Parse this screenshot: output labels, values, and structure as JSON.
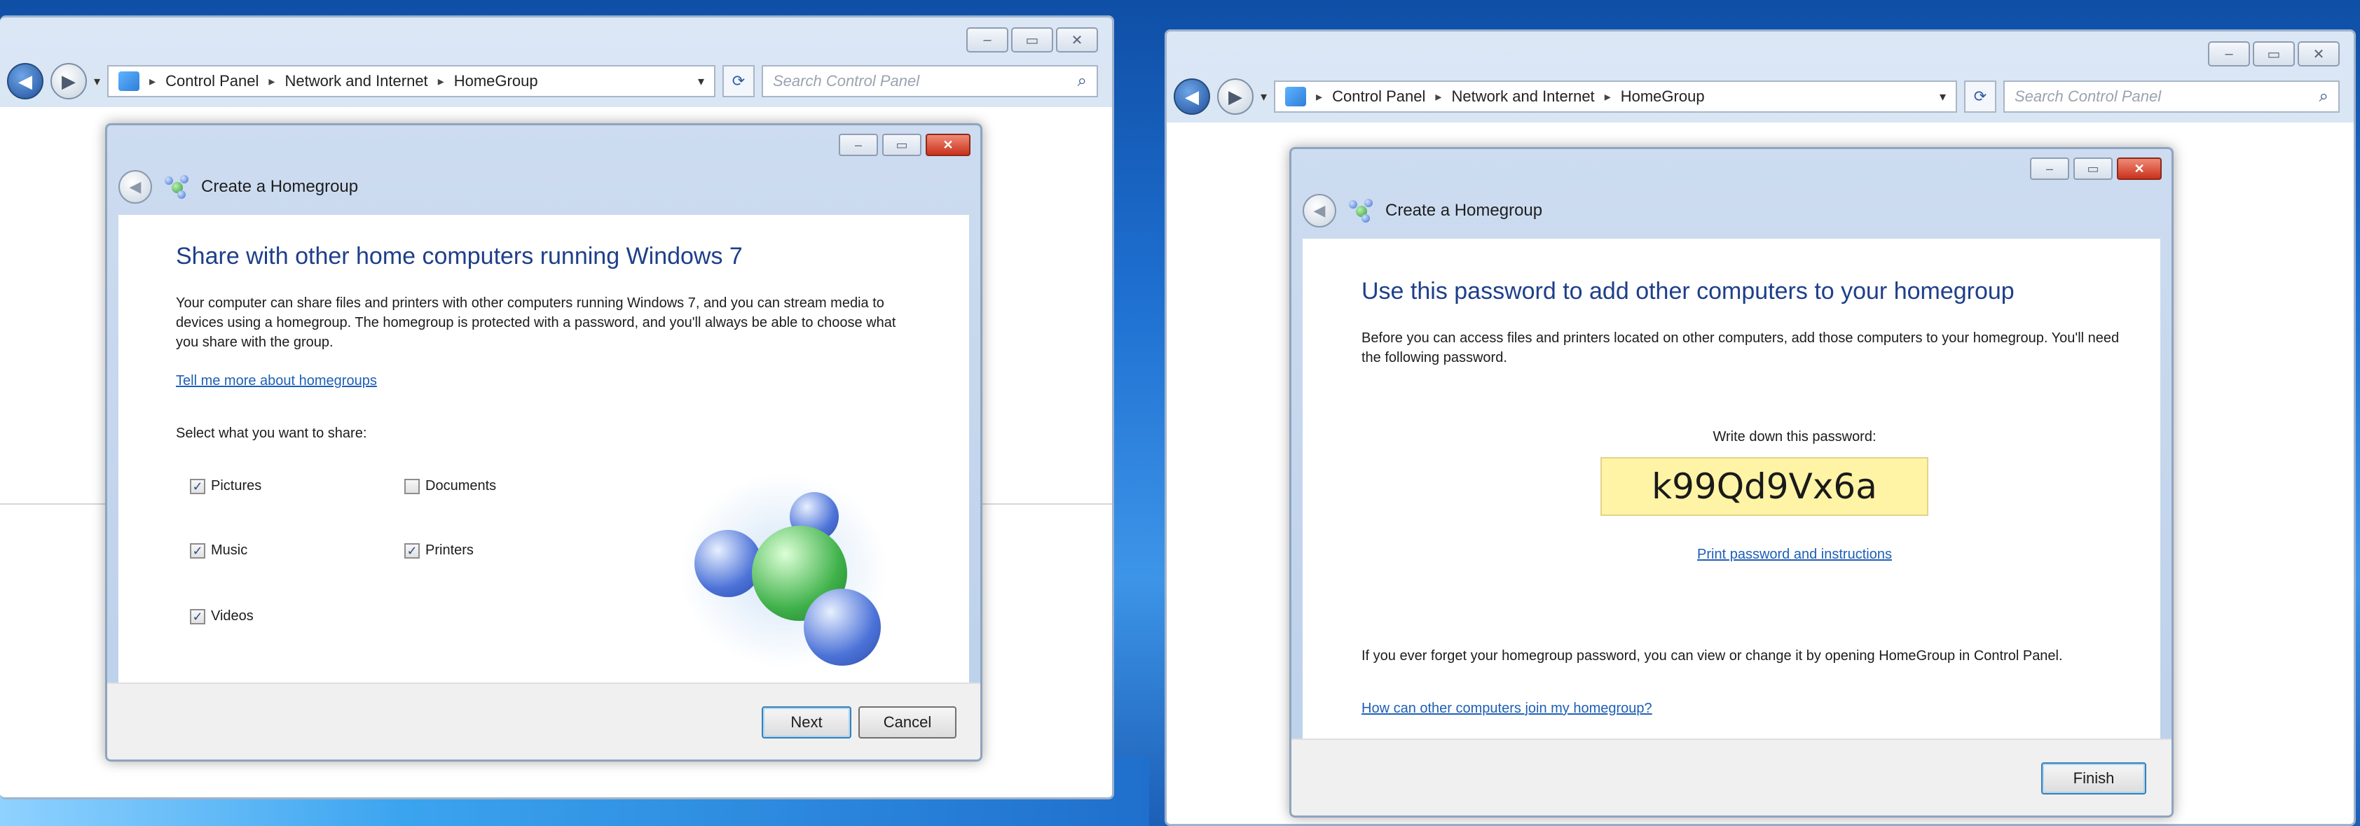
{
  "left_window": {
    "breadcrumb": [
      "Control Panel",
      "Network and Internet",
      "HomeGroup"
    ],
    "search_placeholder": "Search Control Panel",
    "dialog": {
      "title": "Create a Homegroup",
      "heading": "Share with other home computers running Windows 7",
      "description": "Your computer can share files and printers with other computers running Windows 7, and you can stream media to devices using a homegroup. The homegroup is protected with a password, and you'll always be able to choose what you share with the group.",
      "link": "Tell me more about homegroups",
      "select_label": "Select what you want to share:",
      "options": [
        {
          "label": "Pictures",
          "checked": true
        },
        {
          "label": "Documents",
          "checked": false
        },
        {
          "label": "Music",
          "checked": true
        },
        {
          "label": "Printers",
          "checked": true
        },
        {
          "label": "Videos",
          "checked": true
        }
      ],
      "next_label": "Next",
      "cancel_label": "Cancel"
    }
  },
  "right_window": {
    "breadcrumb": [
      "Control Panel",
      "Network and Internet",
      "HomeGroup"
    ],
    "search_placeholder": "Search Control Panel",
    "dialog": {
      "title": "Create a Homegroup",
      "heading": "Use this password to add other computers to your homegroup",
      "description": "Before you can access files and printers located on other computers, add those computers to your homegroup. You'll need the following password.",
      "password_label": "Write down this password:",
      "password": "k99Qd9Vx6a",
      "print_link": "Print password and instructions",
      "forget_text": "If you ever forget your homegroup password, you can view or change it by opening HomeGroup in Control Panel.",
      "join_link": "How can other computers join my homegroup?",
      "finish_label": "Finish"
    }
  },
  "icons": {
    "back": "back-arrow-icon",
    "forward": "forward-arrow-icon",
    "refresh": "refresh-icon",
    "search": "magnifier-icon",
    "homegroup": "homegroup-icon",
    "network": "network-icon"
  },
  "colors": {
    "heading": "#1e3f8a",
    "link": "#1e5fb5",
    "password_highlight": "#fff4a6",
    "close_button": "#c9321c"
  }
}
